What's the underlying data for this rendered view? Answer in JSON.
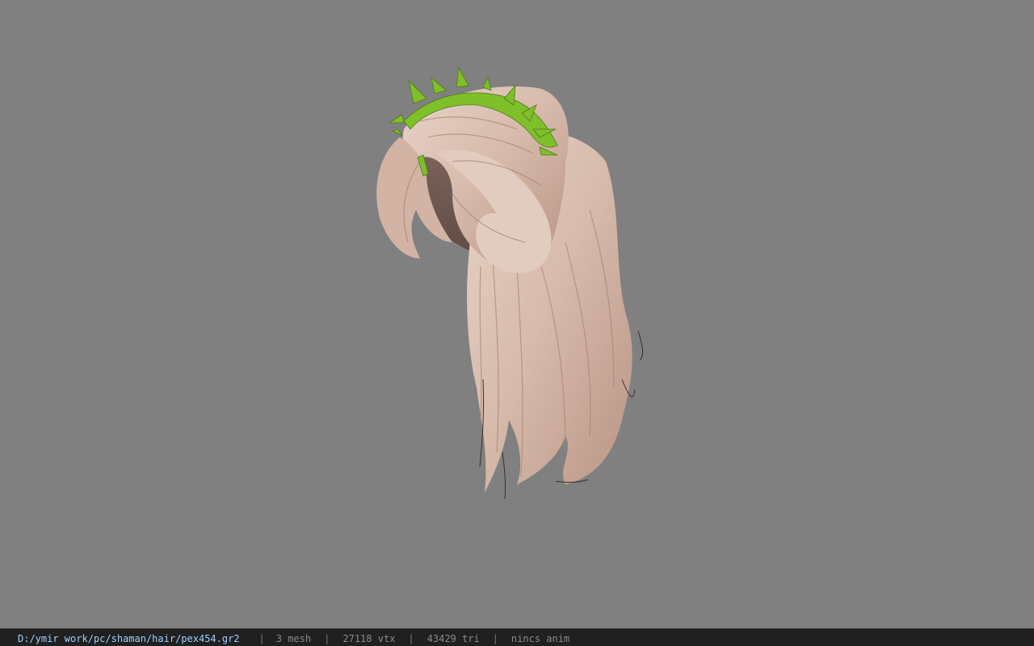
{
  "window": {
    "background_color": "#808080"
  },
  "viewport": {
    "model": {
      "name": "hair-model",
      "hair_color": "#d8bdb0",
      "hair_shadow_color": "#8d7064",
      "accessory_color": "#7fbf2a"
    }
  },
  "status_bar": {
    "file_path": "D:/ymir work/pc/shaman/hair/pex454.gr2",
    "separator": "|",
    "mesh_count": "3 mesh",
    "vertex_count": "27118 vtx",
    "triangle_count": "43429 tri",
    "animation": "nincs anim"
  }
}
